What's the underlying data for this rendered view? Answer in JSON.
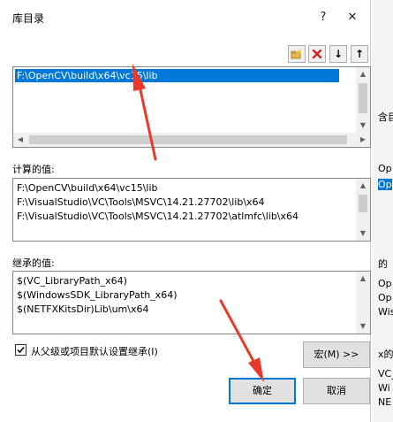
{
  "dialog": {
    "title": "库目录",
    "help_icon": "?",
    "close_icon": "✕"
  },
  "toolbar": {
    "new_line_icon": "new-folder",
    "delete_icon": "delete",
    "down_icon": "↓",
    "up_icon": "↑"
  },
  "editor": {
    "entries": [
      "F:\\OpenCV\\build\\x64\\vc15\\lib"
    ]
  },
  "computed": {
    "label": "计算的值:",
    "lines": [
      "F:\\OpenCV\\build\\x64\\vc15\\lib",
      "F:\\VisualStudio\\VC\\Tools\\MSVC\\14.21.27702\\lib\\x64",
      "F:\\VisualStudio\\VC\\Tools\\MSVC\\14.21.27702\\atlmfc\\lib\\x64"
    ]
  },
  "inherited": {
    "label": "继承的值:",
    "lines": [
      "$(VC_LibraryPath_x64)",
      "$(WindowsSDK_LibraryPath_x64)",
      "$(NETFXKitsDir)Lib\\um\\x64"
    ]
  },
  "inherit_checkbox": {
    "label": "从父级或项目默认设置继承(I)",
    "checked": true
  },
  "buttons": {
    "macro": "宏(M) >>",
    "ok": "确定",
    "cancel": "取消"
  },
  "background_edge": {
    "texts": [
      "含目",
      "Op",
      "Op",
      "的",
      "Op",
      "Op",
      "Wis",
      "x的",
      "VC_",
      "Wi",
      "NE"
    ]
  },
  "colors": {
    "accent": "#0078d7",
    "annotation": "#e8392c"
  }
}
